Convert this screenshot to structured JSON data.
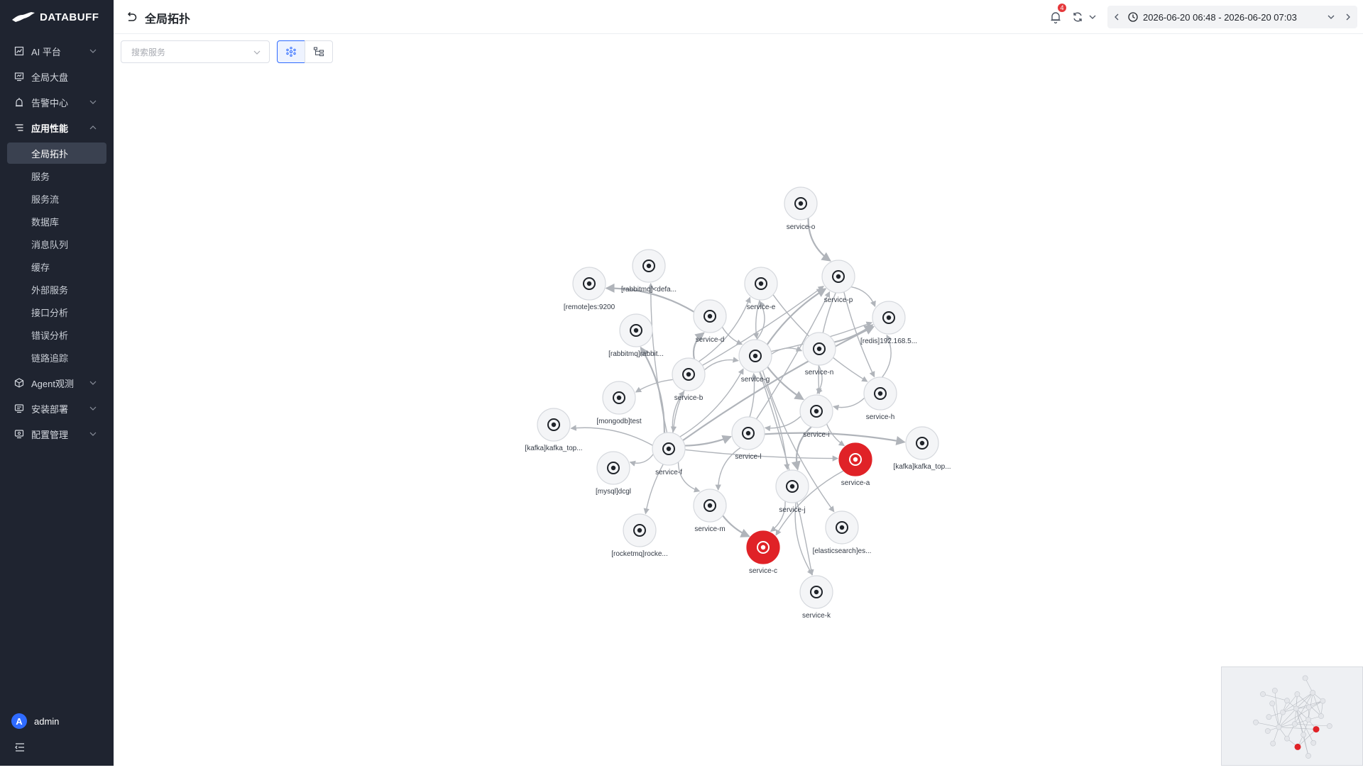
{
  "brand": {
    "name": "DATABUFF"
  },
  "sidebar": {
    "menu": [
      {
        "label": "AI 平台",
        "icon": "chart-icon",
        "expandable": true
      },
      {
        "label": "全局大盘",
        "icon": "dashboard-icon",
        "expandable": false
      },
      {
        "label": "告警中心",
        "icon": "alarm-icon",
        "expandable": true
      },
      {
        "label": "应用性能",
        "icon": "list-icon",
        "expandable": true,
        "expanded": true
      },
      {
        "label": "Agent观测",
        "icon": "cube-icon",
        "expandable": true
      },
      {
        "label": "安装部署",
        "icon": "install-icon",
        "expandable": true
      },
      {
        "label": "配置管理",
        "icon": "config-icon",
        "expandable": true
      }
    ],
    "submenu": [
      {
        "label": "全局拓扑",
        "active": true
      },
      {
        "label": "服务"
      },
      {
        "label": "服务流"
      },
      {
        "label": "数据库"
      },
      {
        "label": "消息队列"
      },
      {
        "label": "缓存"
      },
      {
        "label": "外部服务"
      },
      {
        "label": "接口分析"
      },
      {
        "label": "错误分析"
      },
      {
        "label": "链路追踪"
      }
    ],
    "user": {
      "avatar_letter": "A",
      "name": "admin"
    }
  },
  "header": {
    "title": "全局拓扑",
    "notification_count": "4",
    "time_range": "2026-06-20 06:48 - 2026-06-20 07:03"
  },
  "toolbar": {
    "search_placeholder": "搜索服务",
    "views": [
      "topology-view",
      "tree-view"
    ],
    "active_view": "topology-view"
  },
  "colors": {
    "accent": "#2f6bff",
    "error": "#e02227",
    "sidebar_bg": "#1f2430",
    "edge": "#b0b4ba"
  },
  "topology": {
    "nodes": [
      {
        "id": "o",
        "label": "service-o",
        "status": "normal"
      },
      {
        "id": "p",
        "label": "service-p",
        "status": "normal"
      },
      {
        "id": "e",
        "label": "service-e",
        "status": "normal"
      },
      {
        "id": "d",
        "label": "service-d",
        "status": "normal"
      },
      {
        "id": "g",
        "label": "service-g",
        "status": "normal"
      },
      {
        "id": "n",
        "label": "service-n",
        "status": "normal"
      },
      {
        "id": "b",
        "label": "service-b",
        "status": "normal"
      },
      {
        "id": "h",
        "label": "service-h",
        "status": "normal"
      },
      {
        "id": "i",
        "label": "service-i",
        "status": "normal"
      },
      {
        "id": "l",
        "label": "service-l",
        "status": "normal"
      },
      {
        "id": "f",
        "label": "service-f",
        "status": "normal"
      },
      {
        "id": "a",
        "label": "service-a",
        "status": "error"
      },
      {
        "id": "j",
        "label": "service-j",
        "status": "normal"
      },
      {
        "id": "m",
        "label": "service-m",
        "status": "normal"
      },
      {
        "id": "c",
        "label": "service-c",
        "status": "error"
      },
      {
        "id": "k",
        "label": "service-k",
        "status": "normal"
      },
      {
        "id": "rabbit1",
        "label": "[rabbitmq]<defa...",
        "status": "normal"
      },
      {
        "id": "remote",
        "label": "[remote]es:9200",
        "status": "normal"
      },
      {
        "id": "rabbit2",
        "label": "[rabbitmq]rabbit...",
        "status": "normal"
      },
      {
        "id": "redis",
        "label": "[redis]192.168.5...",
        "status": "normal"
      },
      {
        "id": "mongo",
        "label": "[mongodb]test",
        "status": "normal"
      },
      {
        "id": "kafka1",
        "label": "[kafka]kafka_top...",
        "status": "normal"
      },
      {
        "id": "kafka2",
        "label": "[kafka]kafka_top...",
        "status": "normal"
      },
      {
        "id": "mysql",
        "label": "[mysql]dcgl",
        "status": "normal"
      },
      {
        "id": "es",
        "label": "[elasticsearch]es...",
        "status": "normal"
      },
      {
        "id": "rocket",
        "label": "[rocketmq]rocke...",
        "status": "normal"
      }
    ],
    "edges": [
      [
        "o",
        "p"
      ],
      [
        "p",
        "redis"
      ],
      [
        "p",
        "h"
      ],
      [
        "p",
        "i"
      ],
      [
        "g",
        "p"
      ],
      [
        "g",
        "redis"
      ],
      [
        "g",
        "e"
      ],
      [
        "g",
        "n"
      ],
      [
        "g",
        "i"
      ],
      [
        "g",
        "es"
      ],
      [
        "g",
        "j"
      ],
      [
        "d",
        "g"
      ],
      [
        "d",
        "remote"
      ],
      [
        "b",
        "g"
      ],
      [
        "b",
        "mongo"
      ],
      [
        "b",
        "e"
      ],
      [
        "b",
        "d"
      ],
      [
        "b",
        "p"
      ],
      [
        "f",
        "g"
      ],
      [
        "f",
        "b"
      ],
      [
        "f",
        "l"
      ],
      [
        "f",
        "kafka1"
      ],
      [
        "f",
        "mysql"
      ],
      [
        "f",
        "rocket"
      ],
      [
        "f",
        "rabbit2"
      ],
      [
        "f",
        "rabbit1"
      ],
      [
        "f",
        "a"
      ],
      [
        "f",
        "m"
      ],
      [
        "f",
        "redis"
      ],
      [
        "e",
        "g"
      ],
      [
        "e",
        "h"
      ],
      [
        "n",
        "i"
      ],
      [
        "n",
        "redis"
      ],
      [
        "h",
        "redis"
      ],
      [
        "h",
        "i"
      ],
      [
        "i",
        "a"
      ],
      [
        "i",
        "j"
      ],
      [
        "i",
        "l"
      ],
      [
        "l",
        "g"
      ],
      [
        "l",
        "m"
      ],
      [
        "l",
        "kafka2"
      ],
      [
        "l",
        "p"
      ],
      [
        "j",
        "k"
      ],
      [
        "j",
        "c"
      ],
      [
        "m",
        "c"
      ],
      [
        "a",
        "c"
      ],
      [
        "g",
        "k"
      ],
      [
        "b",
        "f"
      ]
    ]
  }
}
